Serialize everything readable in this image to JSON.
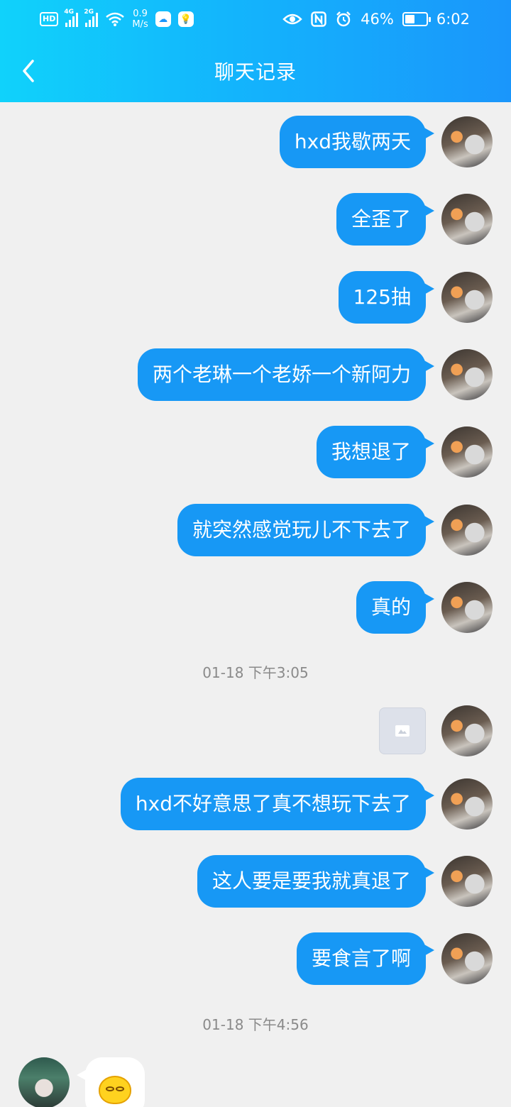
{
  "status_bar": {
    "hd": "HD",
    "sim1_type": "4G",
    "sim2_type": "2G",
    "speed_value": "0.9",
    "speed_unit": "M/s",
    "battery": "46%",
    "battery_level": 0.46,
    "time": "6:02"
  },
  "header": {
    "title": "聊天记录"
  },
  "messages_before": [
    {
      "text": "hxd我歇两天"
    },
    {
      "text": "全歪了"
    },
    {
      "text": "125抽"
    },
    {
      "text": "两个老琳一个老娇一个新阿力"
    },
    {
      "text": "我想退了"
    },
    {
      "text": "就突然感觉玩儿不下去了"
    },
    {
      "text": "真的"
    }
  ],
  "timestamp1": "01-18 下午3:05",
  "messages_after": [
    {
      "text": "hxd不好意思了真不想玩下去了"
    },
    {
      "text": "这人要是要我就真退了"
    },
    {
      "text": "要食言了啊"
    }
  ],
  "timestamp2": "01-18 下午4:56",
  "colors": {
    "bubble": "#1798f5",
    "header_start": "#10d2fb",
    "header_end": "#1a96fb",
    "background": "#f0f0f0"
  }
}
